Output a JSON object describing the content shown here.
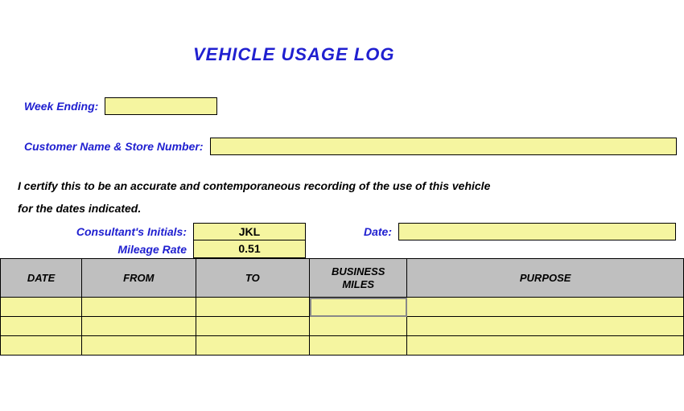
{
  "title": "VEHICLE USAGE LOG",
  "labels": {
    "week_ending": "Week Ending:",
    "customer": "Customer Name & Store Number:",
    "cert_line1": "I certify this to be an accurate and contemporaneous recording of the use of this vehicle",
    "cert_line2": "for the dates indicated.",
    "consultant_initials": "Consultant's Initials:",
    "mileage_rate": "Mileage Rate",
    "date_label": "Date:"
  },
  "fields": {
    "week_ending": "",
    "customer": "",
    "initials": "JKL",
    "mileage_rate": "0.51",
    "date": ""
  },
  "table": {
    "headers": {
      "date": "DATE",
      "from": "FROM",
      "to": "TO",
      "miles_top": "BUSINESS",
      "miles_bottom": "MILES",
      "purpose": "PURPOSE"
    },
    "rows": [
      {
        "date": "",
        "from": "",
        "to": "",
        "miles": "",
        "purpose": ""
      },
      {
        "date": "",
        "from": "",
        "to": "",
        "miles": "",
        "purpose": ""
      },
      {
        "date": "",
        "from": "",
        "to": "",
        "miles": "",
        "purpose": ""
      }
    ]
  }
}
